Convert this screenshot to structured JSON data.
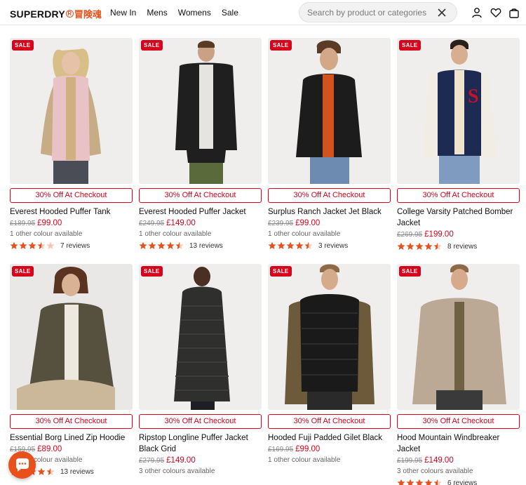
{
  "header": {
    "logo": "SUPERDRY",
    "logo_reg": "R",
    "logo_jp": "冒険魂",
    "nav": [
      "New In",
      "Mens",
      "Womens",
      "Sale"
    ],
    "search_placeholder": "Search by product or categories",
    "icons": [
      "account-icon",
      "wishlist-heart-icon",
      "bag-icon"
    ]
  },
  "colors": {
    "brand_orange": "#e8501c",
    "sale_red": "#d9001b",
    "star": "#e8501c"
  },
  "products": [
    {
      "badge": "SALE",
      "promo": "30% Off At Checkout",
      "name": "Everest Hooded Puffer Tank",
      "was": "£189.95",
      "now": "£99.00",
      "colours": "1 other colour available",
      "rating": 3.5,
      "reviews": "7 reviews"
    },
    {
      "badge": "SALE",
      "promo": "30% Off At Checkout",
      "name": "Everest Hooded Puffer Jacket",
      "was": "£249.95",
      "now": "£149.00",
      "colours": "1 other colour available",
      "rating": 4.5,
      "reviews": "13 reviews"
    },
    {
      "badge": "SALE",
      "promo": "30% Off At Checkout",
      "name": "Surplus Ranch Jacket Jet Black",
      "was": "£239.95",
      "now": "£99.00",
      "colours": "1 other colour available",
      "rating": 4.5,
      "reviews": "3 reviews"
    },
    {
      "badge": "SALE",
      "promo": "30% Off At Checkout",
      "name": "College Varsity Patched Bomber Jacket",
      "was": "£269.95",
      "now": "£199.00",
      "colours": "",
      "rating": 4.5,
      "reviews": "8 reviews"
    },
    {
      "badge": "SALE",
      "promo": "30% Off At Checkout",
      "name": "Essential Borg Lined Zip Hoodie",
      "was": "£159.95",
      "now": "£89.00",
      "colours": "1 other colour available",
      "rating": 4.5,
      "reviews": "13 reviews"
    },
    {
      "badge": "SALE",
      "promo": "30% Off At Checkout",
      "name": "Ripstop Longline Puffer Jacket Black Grid",
      "was": "£279.95",
      "now": "£149.00",
      "colours": "3 other colours available",
      "rating": 0,
      "reviews": ""
    },
    {
      "badge": "SALE",
      "promo": "30% Off At Checkout",
      "name": "Hooded Fuji Padded Gilet Black",
      "was": "£169.95",
      "now": "£99.00",
      "colours": "1 other colour available",
      "rating": 0,
      "reviews": ""
    },
    {
      "badge": "SALE",
      "promo": "30% Off At Checkout",
      "name": "Hood Mountain Windbreaker Jacket",
      "was": "£199.95",
      "now": "£149.00",
      "colours": "3 other colours available",
      "rating": 4.5,
      "reviews": "6 reviews"
    }
  ],
  "chat": {
    "icon": "chat-bubble-icon"
  }
}
